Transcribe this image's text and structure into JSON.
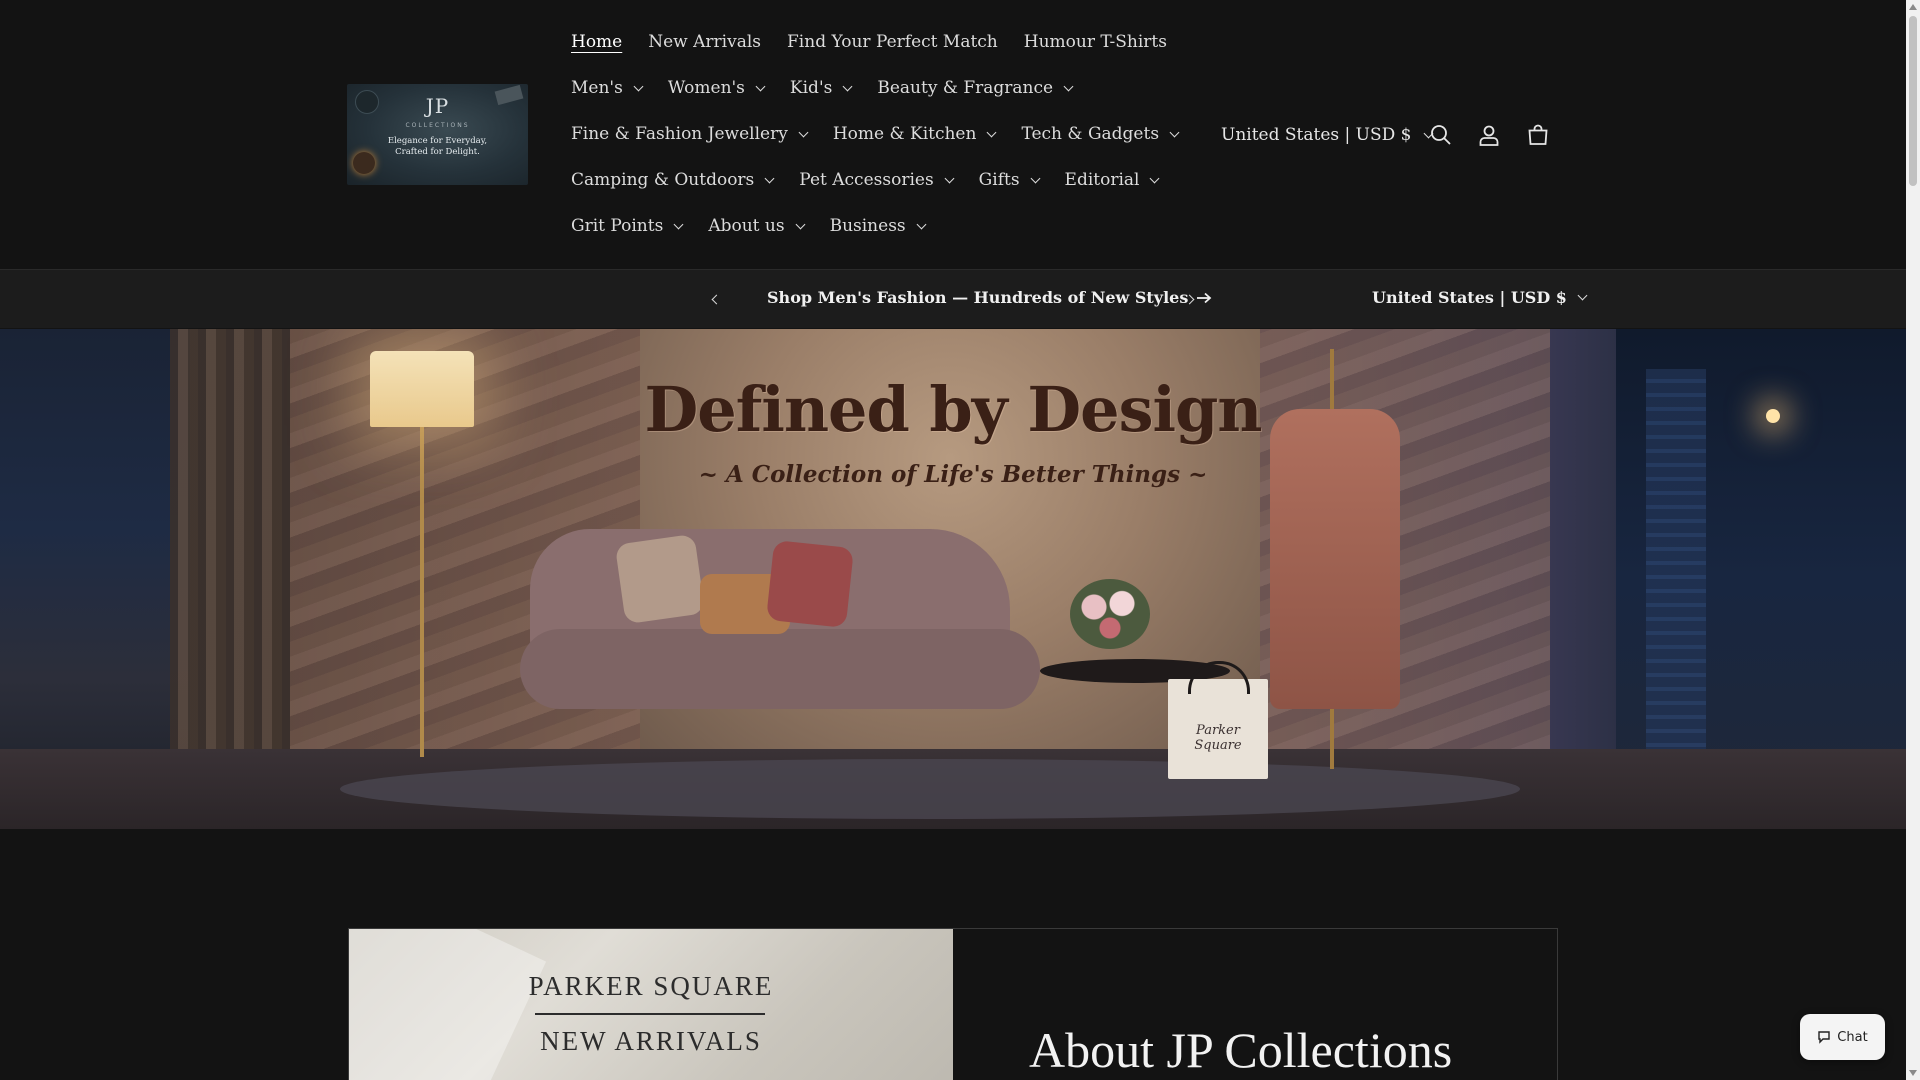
{
  "header": {
    "logo": {
      "monogram": "JP",
      "brand": "COLLECTIONS",
      "tagline_line1": "Elegance for Everyday,",
      "tagline_line2": "Crafted for Delight."
    },
    "nav_rows": [
      [
        {
          "label": "Home",
          "active": true,
          "dropdown": false
        },
        {
          "label": "New Arrivals",
          "dropdown": false
        },
        {
          "label": "Find Your Perfect Match",
          "dropdown": false
        },
        {
          "label": "Humour T-Shirts",
          "dropdown": false
        }
      ],
      [
        {
          "label": "Men's",
          "dropdown": true
        },
        {
          "label": "Women's",
          "dropdown": true
        },
        {
          "label": "Kid's",
          "dropdown": true
        },
        {
          "label": "Beauty & Fragrance",
          "dropdown": true
        }
      ],
      [
        {
          "label": "Fine & Fashion Jewellery",
          "dropdown": true
        },
        {
          "label": "Home & Kitchen",
          "dropdown": true
        },
        {
          "label": "Tech & Gadgets",
          "dropdown": true
        }
      ],
      [
        {
          "label": "Camping & Outdoors",
          "dropdown": true
        },
        {
          "label": "Pet Accessories",
          "dropdown": true
        },
        {
          "label": "Gifts",
          "dropdown": true
        },
        {
          "label": "Editorial",
          "dropdown": true
        }
      ],
      [
        {
          "label": "Grit Points",
          "dropdown": true
        },
        {
          "label": "About us",
          "dropdown": true
        },
        {
          "label": "Business",
          "dropdown": true
        }
      ]
    ],
    "country_selector": "United States | USD $",
    "icons": [
      "search-icon",
      "account-icon",
      "cart-icon"
    ]
  },
  "announcement": {
    "text": "Shop Men's Fashion — Hundreds of New Styles",
    "country_selector": "United States | USD $"
  },
  "hero": {
    "title": "Defined by Design",
    "subtitle": "~ A Collection of Life's Better Things ~",
    "bag_label": "Parker Square"
  },
  "about": {
    "image_line1": "PARKER SQUARE",
    "image_line2": "NEW ARRIVALS",
    "title": "About JP Collections"
  },
  "chat": {
    "label": "Chat"
  },
  "colors": {
    "background": "#131313",
    "announcement_bg": "#1c1c1c",
    "text": "#dcdcdc",
    "chat_bg": "#f4f4f4"
  }
}
